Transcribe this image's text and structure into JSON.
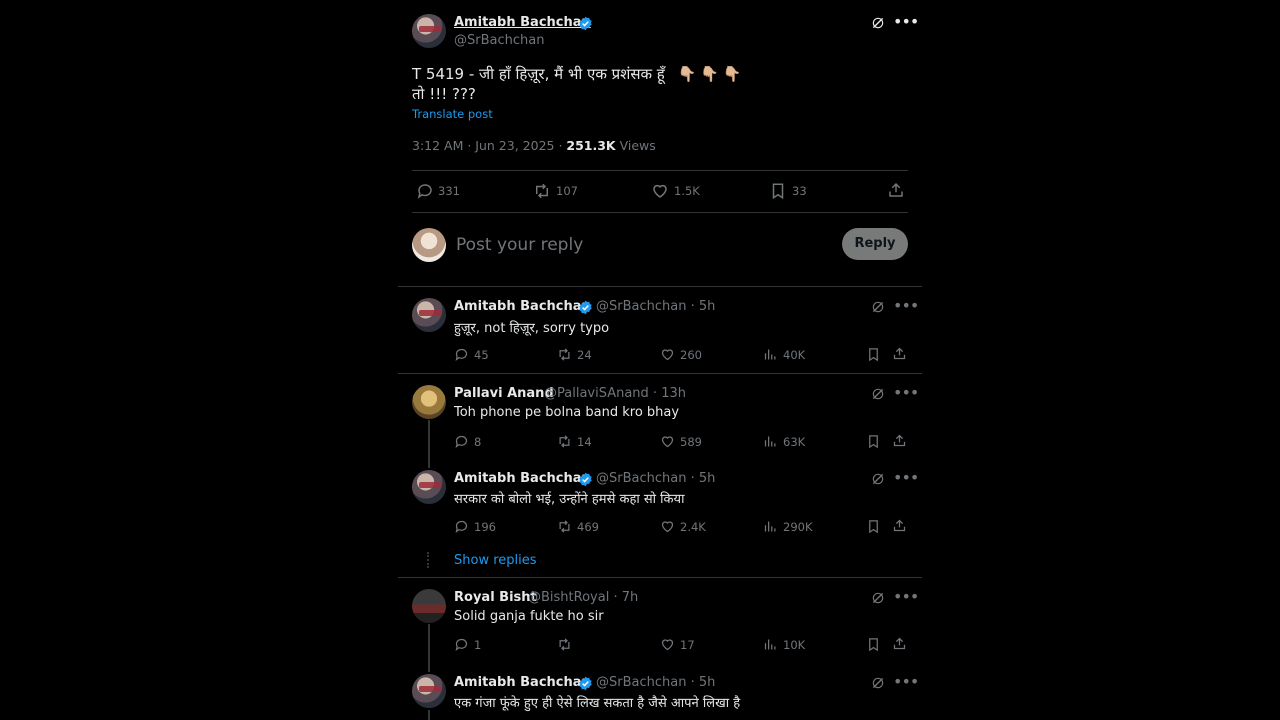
{
  "main_post": {
    "author_name": "Amitabh Bachchan",
    "handle": "@SrBachchan",
    "text_line1": "T 5419 - जी हाँ हिज़ूर, मैं भी एक प्रशंसक हूँ",
    "emojis": "👇🏼👇🏼👇🏼",
    "text_line2": "तो !!! ???",
    "translate": "Translate post",
    "timestamp": "3:12 AM · Jun 23, 2025 · ",
    "views_count": "251.3K",
    "views_label": " Views",
    "stats": {
      "replies": "331",
      "reposts": "107",
      "likes": "1.5K",
      "bookmarks": "33"
    }
  },
  "composer": {
    "placeholder": "Post your reply",
    "reply_button": "Reply"
  },
  "replies": [
    {
      "author_name": "Amitabh Bachchan",
      "handle": "@SrBachchan · 5h",
      "text": "हुज़ूर, not हिज़ूर, sorry typo",
      "replies": "45",
      "reposts": "24",
      "likes": "260",
      "views": "40K"
    },
    {
      "author_name": "Pallavi Anand",
      "handle": "@PallaviSAnand · 13h",
      "text": "Toh phone pe bolna band kro bhay",
      "replies": "8",
      "reposts": "14",
      "likes": "589",
      "views": "63K"
    },
    {
      "author_name": "Amitabh Bachchan",
      "handle": "@SrBachchan · 5h",
      "text": "सरकार को बोलो भई, उन्होंने हमसे कहा सो किया",
      "replies": "196",
      "reposts": "469",
      "likes": "2.4K",
      "views": "290K"
    },
    {
      "author_name": "Royal Bisht",
      "handle": "@BishtRoyal · 7h",
      "text": "Solid ganja fukte ho sir",
      "replies": "1",
      "reposts": "",
      "likes": "17",
      "views": "10K"
    },
    {
      "author_name": "Amitabh Bachchan",
      "handle": "@SrBachchan · 5h",
      "text": "एक गंजा फूंके हुए ही ऐसे लिख सकता है जैसे आपने लिखा है"
    }
  ],
  "show_replies": "Show replies",
  "colors": {
    "background": "#000000",
    "accent": "#1d9bf0",
    "muted": "#71767b",
    "divider": "#2f3336"
  }
}
